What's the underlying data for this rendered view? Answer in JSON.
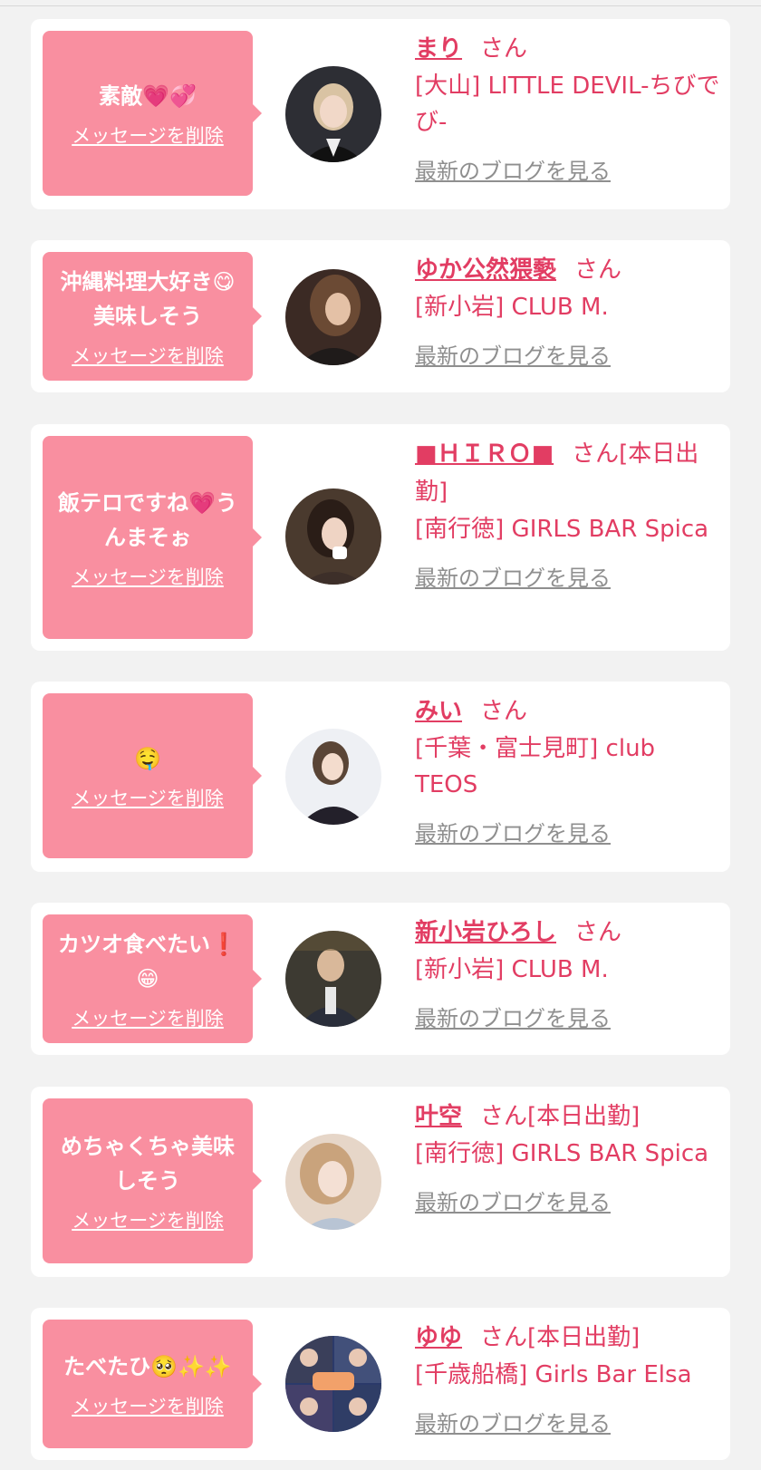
{
  "colors": {
    "accent": "#e23d63",
    "bubble": "#f98fa0",
    "link_gray": "#8f8f8f",
    "background": "#f2f2f2"
  },
  "delete_label": "メッセージを削除",
  "blog_label": "最新のブログを見る",
  "entries": [
    {
      "message": "素敵💗💞",
      "name": "まり",
      "suffix": "さん",
      "shop": "[大山] LITTLE DEVIL-ちびでび-",
      "avatar_icon": "avatar-icon"
    },
    {
      "message": "沖縄料理大好き😋\n美味しそう",
      "name": "ゆか公然猥褻",
      "suffix": "さん",
      "shop": "[新小岩] CLUB M.",
      "avatar_icon": "avatar-icon"
    },
    {
      "message": "飯テロですね💗う\nんまそぉ",
      "name": "■ＨＩＲＯ■",
      "suffix": "さん[本日出勤]",
      "shop": "[南行徳] GIRLS BAR Spica",
      "avatar_icon": "avatar-icon"
    },
    {
      "message": "🤤",
      "name": "みい",
      "suffix": "さん",
      "shop": "[千葉・富士見町] club TEOS",
      "avatar_icon": "avatar-icon"
    },
    {
      "message": "カツオ食べたい❗️\n😁",
      "name": "新小岩ひろし",
      "suffix": "さん",
      "shop": "[新小岩] CLUB M.",
      "avatar_icon": "avatar-icon"
    },
    {
      "message": "めちゃくちゃ美味\nしそう",
      "name": "叶空",
      "suffix": "さん[本日出勤]",
      "shop": "[南行徳] GIRLS BAR Spica",
      "avatar_icon": "avatar-icon"
    },
    {
      "message": "たべたひ🥺✨✨",
      "name": "ゆゆ",
      "suffix": "さん[本日出勤]",
      "shop": "[千歳船橋] Girls Bar Elsa",
      "avatar_icon": "avatar-icon"
    }
  ]
}
